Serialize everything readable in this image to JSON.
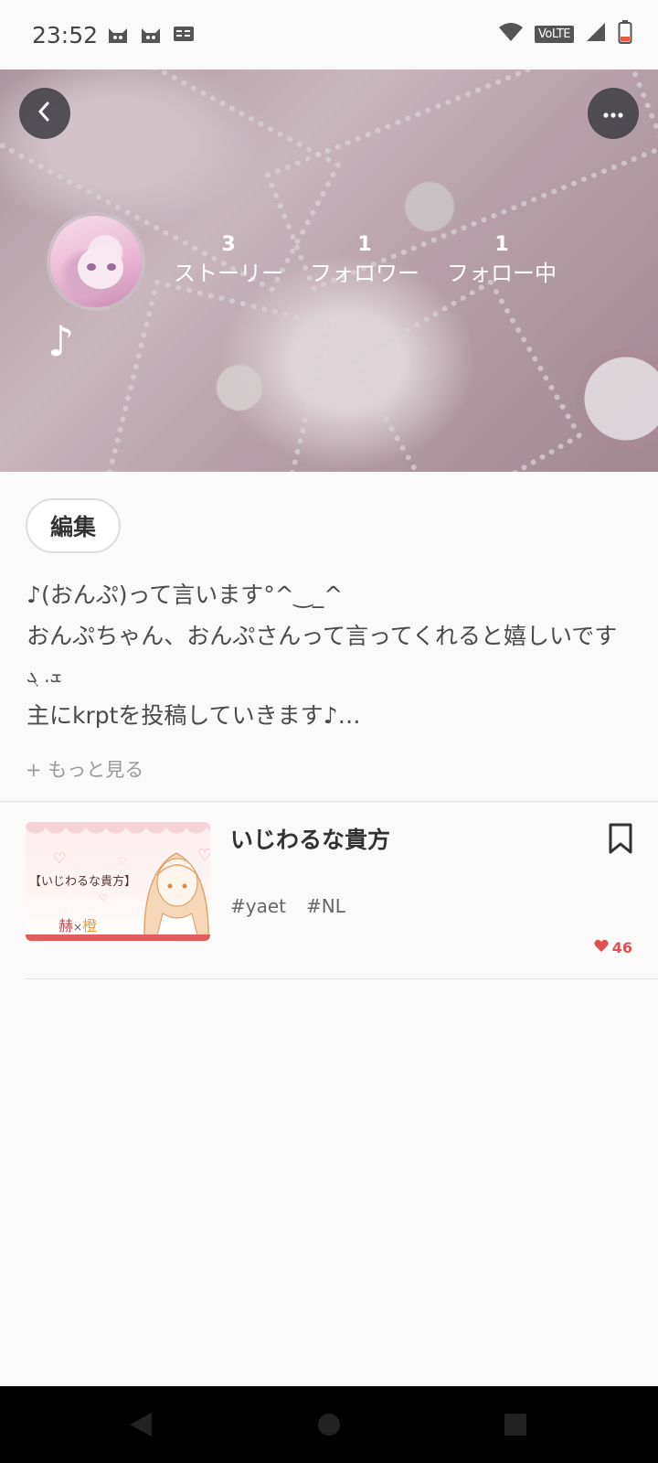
{
  "status_bar": {
    "time": "23:52",
    "left_icons": [
      "cat-app-icon",
      "cat-app-icon",
      "keyboard-icon"
    ],
    "volte": "VoLTE",
    "right_icons": [
      "wifi-icon",
      "volte-icon",
      "signal-icon",
      "battery-icon"
    ]
  },
  "header": {
    "back_icon": "chevron-left-icon",
    "more_icon": "more-horizontal-icon",
    "username": "♪",
    "stats": [
      {
        "count": "3",
        "label": "ストーリー"
      },
      {
        "count": "1",
        "label": "フォロワー"
      },
      {
        "count": "1",
        "label": "フォロー中"
      }
    ]
  },
  "profile": {
    "edit_label": "編集",
    "bio_lines": [
      "♪(おんぷ)って言います°^‿_^",
      "おんぷちゃん、おんぷさんって言ってくれると嬉しいです",
      "ܫ. ܓ",
      "主にkrptを投稿していきます♪…"
    ],
    "more_label": "+ もっと見る"
  },
  "stories": [
    {
      "title": "いじわるな貴方",
      "thumbnail": {
        "title": "【いじわるな貴方】",
        "name_a": "赫",
        "cross": "×",
        "name_b": "橙"
      },
      "tags": [
        "#yaet",
        "#NL"
      ],
      "likes": "46",
      "bookmark_icon": "bookmark-icon"
    }
  ],
  "colors": {
    "accent_red": "#e05050",
    "header_pink": "#c4aeb5"
  }
}
